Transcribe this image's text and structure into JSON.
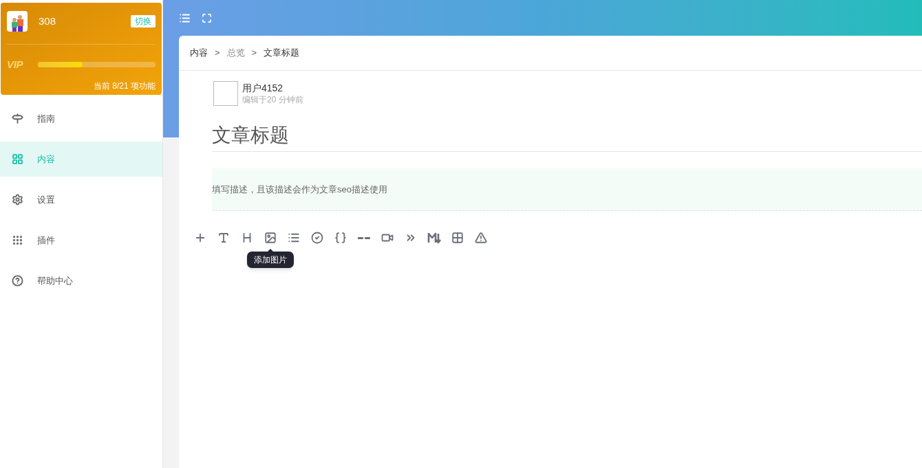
{
  "profile": {
    "name": "308",
    "switch_button": "切换",
    "vip_label": "VIP",
    "level": 0.38,
    "progress_text": "当前 8/21 项功能"
  },
  "sidebar": {
    "items": [
      {
        "kind": "signpost",
        "label": "指南",
        "selected": false
      },
      {
        "kind": "grid",
        "label": "内容",
        "selected": true
      },
      {
        "kind": "gear",
        "label": "设置",
        "selected": false
      },
      {
        "kind": "dots",
        "label": "插件",
        "selected": false
      },
      {
        "kind": "help",
        "label": "帮助中心",
        "selected": false
      }
    ]
  },
  "breadcrumb": [
    {
      "label": "内容",
      "muted": false
    },
    {
      "label": "总览",
      "muted": true
    },
    {
      "label": "文章标题",
      "muted": false
    }
  ],
  "breadcrumb_separator": ">",
  "author": {
    "name": "用户4152",
    "edited": "编辑于20 分钟前"
  },
  "article": {
    "title": "文章标题",
    "description": "填写描述，且该描述会作为文章seo描述使用"
  },
  "toolbar": [
    {
      "kind": "plus"
    },
    {
      "kind": "text"
    },
    {
      "kind": "heading"
    },
    {
      "kind": "image",
      "tooltip": "添加图片"
    },
    {
      "kind": "list"
    },
    {
      "kind": "check"
    },
    {
      "kind": "code"
    },
    {
      "kind": "divider"
    },
    {
      "kind": "video"
    },
    {
      "kind": "quote"
    },
    {
      "kind": "markdown"
    },
    {
      "kind": "table"
    },
    {
      "kind": "warning"
    }
  ]
}
